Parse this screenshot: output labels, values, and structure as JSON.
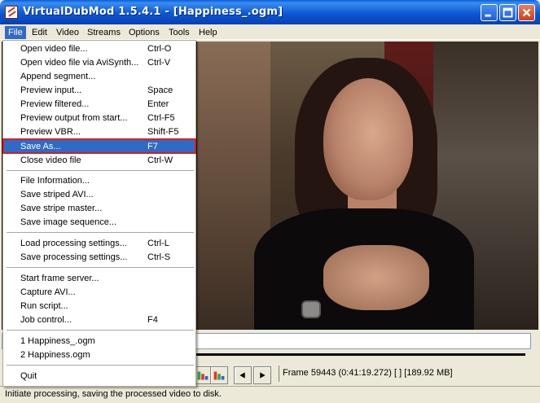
{
  "window": {
    "title": "VirtualDubMod 1.5.4.1 - [Happiness_.ogm]",
    "minimize_icon": "minimize-icon",
    "maximize_icon": "maximize-icon",
    "close_icon": "close-icon"
  },
  "menubar": {
    "items": [
      "File",
      "Edit",
      "Video",
      "Streams",
      "Options",
      "Tools",
      "Help"
    ]
  },
  "file_menu": {
    "items": [
      {
        "label": "Open video file...",
        "shortcut": "Ctrl-O"
      },
      {
        "label": "Open video file via AviSynth...",
        "shortcut": "Ctrl-V"
      },
      {
        "label": "Append segment...",
        "shortcut": ""
      },
      {
        "label": "Preview input...",
        "shortcut": "Space"
      },
      {
        "label": "Preview filtered...",
        "shortcut": "Enter"
      },
      {
        "label": "Preview output from start...",
        "shortcut": "Ctrl-F5"
      },
      {
        "label": "Preview VBR...",
        "shortcut": "Shift-F5"
      },
      {
        "label": "Save As...",
        "shortcut": "F7"
      },
      {
        "label": "Close video file",
        "shortcut": "Ctrl-W"
      },
      {
        "label": "File Information...",
        "shortcut": ""
      },
      {
        "label": "Save striped AVI...",
        "shortcut": ""
      },
      {
        "label": "Save stripe master...",
        "shortcut": ""
      },
      {
        "label": "Save image sequence...",
        "shortcut": ""
      },
      {
        "label": "Load processing settings...",
        "shortcut": "Ctrl-L"
      },
      {
        "label": "Save processing settings...",
        "shortcut": "Ctrl-S"
      },
      {
        "label": "Start frame server...",
        "shortcut": ""
      },
      {
        "label": "Capture AVI...",
        "shortcut": ""
      },
      {
        "label": "Run script...",
        "shortcut": ""
      },
      {
        "label": "Job control...",
        "shortcut": "F4"
      },
      {
        "label": "1 Happiness_.ogm",
        "shortcut": ""
      },
      {
        "label": "2 Happiness.ogm",
        "shortcut": ""
      },
      {
        "label": "Quit",
        "shortcut": ""
      }
    ],
    "highlighted": "Save As..."
  },
  "position": {
    "frame_status": "Frame 59443 (0:41:19.272) [ ] [189.92 MB]"
  },
  "status_bar": {
    "text": "Initiate processing, saving the processed video to disk."
  }
}
